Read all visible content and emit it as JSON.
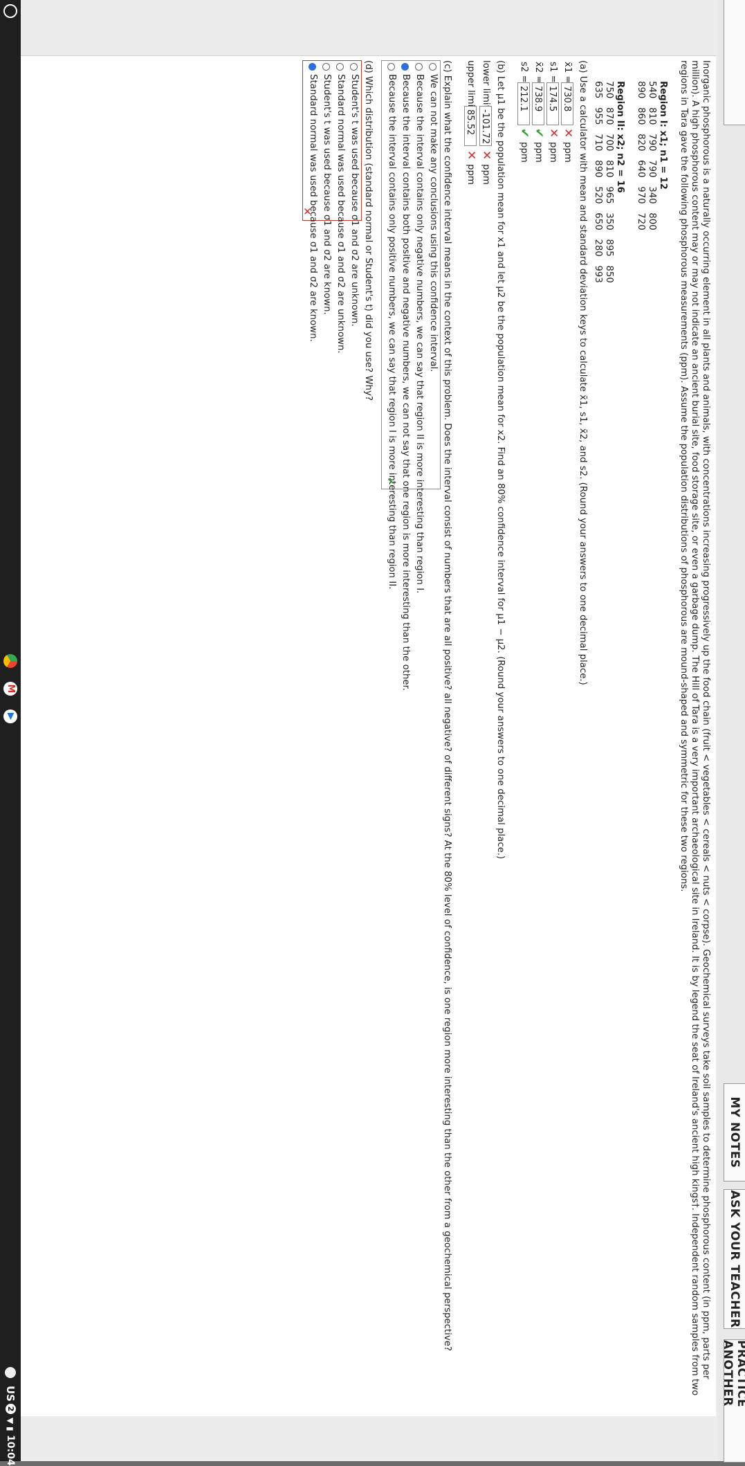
{
  "header": {
    "practice_another": "PRACTICE ANOTHER",
    "ask_teacher": "ASK YOUR TEACHER",
    "my_notes": "MY NOTES"
  },
  "problem": {
    "intro_1": "Inorganic phosphorous is a naturally occurring element in all plants and animals, with concentrations increasing progressively up the food chain (fruit < vegetables < cereals < nuts < corpse). Geochemical surveys take soil samples to determine phosphorous content (in ppm, parts per",
    "intro_2": "million). A high phosphorous content may or may not indicate an ancient burial site, food storage site, or even a garbage dump. The Hill of Tara is a very important archaeological site in Ireland. It is by legend the seat of Ireland's ancient high kings†. Independent random samples from two",
    "intro_3": "regions in Tara gave the following phosphorous measurements (ppm). Assume the population distributions of phosphorous are mound-shaped and symmetric for these two regions.",
    "region1_label": "Region I: x1; n1 = 12",
    "region1_row1": "540   810   790   790   340   800",
    "region1_row2": "890   860   820   640   970   720",
    "region2_label": "Region II: x2; n2 = 16",
    "region2_row1": "750   870   700   810   965   350   895   850",
    "region2_row2": "635   955   710   890   520   650   280   993"
  },
  "part_a": {
    "prompt": "(a) Use a calculator with mean and standard deviation keys to calculate x̄1, s1, x̄2, and s2. (Round your answers to one decimal place.)",
    "rows": [
      {
        "label": "x̄1 =",
        "value": "730.8",
        "unit": "ppm",
        "status": "incorrect"
      },
      {
        "label": "s1 =",
        "value": "174.5",
        "unit": "ppm",
        "status": "incorrect"
      },
      {
        "label": "x̄2 =",
        "value": "738.9",
        "unit": "ppm",
        "status": "correct"
      },
      {
        "label": "s2 =",
        "value": "212.1",
        "unit": "ppm",
        "status": "correct"
      }
    ]
  },
  "part_b": {
    "prompt": "(b) Let μ1 be the population mean for x1 and let μ2 be the population mean for x2. Find an 80% confidence interval for μ1 − μ2. (Round your answers to one decimal place.)",
    "lower_label": "lower limit",
    "lower_value": "-101.72",
    "upper_label": "upper limit",
    "upper_value": "85.52",
    "unit": "ppm"
  },
  "part_c": {
    "prompt": "(c) Explain what the confidence interval means in the context of this problem. Does the interval consist of numbers that are all positive? all negative? of different signs? At the 80% level of confidence, is one region more interesting than the other from a geochemical perspective?",
    "options": [
      "We can not make any conclusions using this confidence interval.",
      "Because the interval contains only negative numbers, we can say that region II is more interesting than region I.",
      "Because the interval contains both positive and negative numbers, we can not say that one region is more interesting than the other.",
      "Because the interval contains only positive numbers, we can say that region I is more interesting than region II."
    ],
    "selected": 2,
    "status": "correct"
  },
  "part_d": {
    "prompt": "(d) Which distribution (standard normal or Student's t) did you use? Why?",
    "options": [
      "Student's t was used because σ1 and σ2 are unknown.",
      "Standard normal was used because σ1 and σ2 are unknown.",
      "Student's t was used because σ1 and σ2 are known.",
      "Standard normal was used because σ1 and σ2 are known."
    ],
    "selected": 3,
    "status": "incorrect"
  },
  "taskbar": {
    "region": "US",
    "badge": "2",
    "time": "10:04"
  },
  "colors": {
    "incorrect": "#d32f2f",
    "correct": "#3a9d3a",
    "selected_radio": "#2f6fd6"
  }
}
